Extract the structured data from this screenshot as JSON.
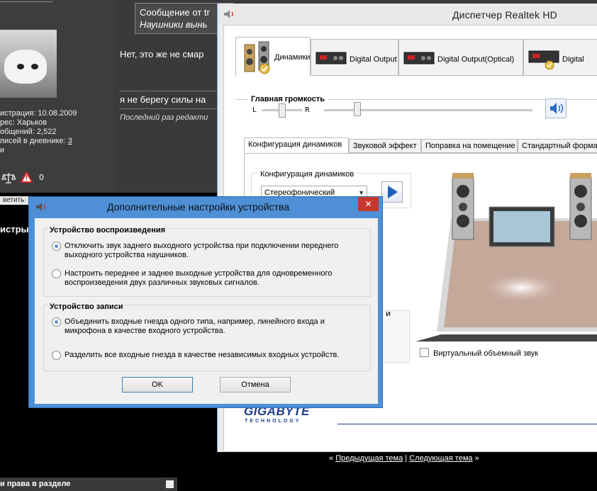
{
  "forum": {
    "profile_lines": [
      "истрация: 10.08.2009",
      "рес: Харьков",
      "общений: 2,522",
      "писей в дневнике: "
    ],
    "diary_count": "3",
    "small_char": "и",
    "icon_count": "0",
    "reply_button": "ветить",
    "left_stub": "истры",
    "quote_line1": "Сообщение от tr",
    "quote_line2": "Наушники вынь",
    "post1": "Нет, это же не смар",
    "post2": "я не берегу силы на",
    "edited": "Последний раз редакти",
    "nav_prev_marker": "«",
    "nav_prev": "Предыдущая тема",
    "nav_separator": "|",
    "nav_next": "Следующая тема",
    "nav_next_marker": "»",
    "permissions": "и права в разделе"
  },
  "realtek": {
    "title": "Диспетчер Realtek HD",
    "device_tabs": [
      "Динамики",
      "Digital Output",
      "Digital Output(Optical)",
      "Digital"
    ],
    "volume_label": "Главная громкость",
    "left": "L",
    "right": "R",
    "config_tabs": [
      "Конфигурация динамиков",
      "Звуковой эффект",
      "Поправка на помещение",
      "Стандартный формат"
    ],
    "config_group_label": "Конфигурация динамиков",
    "config_selected": "Стереофонический",
    "ghost_text": "и",
    "virtual_surround": "Виртуальный объемный звук",
    "brand": "GIGABYTE",
    "brand_sub": "TECHNOLOGY",
    "volume_master": 0.16,
    "volume_balance": 0.5
  },
  "dialog": {
    "title": "Дополнительные настройки устройства",
    "close": "✕",
    "playback_group": "Устройство воспроизведения",
    "playback_opt1": "Отключить звук заднего выходного устройства при подключении переднего выходного устройства наушников.",
    "playback_opt2": "Настроить переднее и заднее выходные устройства для одновременного воспроизведения двух различных звуковых сигналов.",
    "record_group": "Устройство записи",
    "record_opt1": "Объединить входные гнезда одного типа, например, линейного входа и микрофона в качестве входного устройства.",
    "record_opt2": "Разделить все входные гнезда в качестве независимых входных устройств.",
    "ok": "OK",
    "cancel": "Отмена"
  }
}
